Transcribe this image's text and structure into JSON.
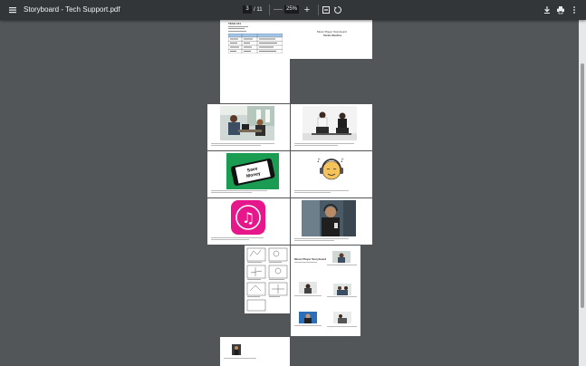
{
  "app": {
    "document_title": "Storyboard - Tech Support.pdf",
    "current_page": "3",
    "total_pages": "/ 11",
    "zoom_level": "25%",
    "zoom_out": "—",
    "zoom_in": "+"
  },
  "icons": {
    "menu": "menu-icon",
    "fit": "fit-page-icon",
    "rotate": "rotate-icon",
    "download": "download-icon",
    "print": "print-icon",
    "more": "more-vert-icon"
  },
  "pages": {
    "p1_heading": "TECH 101",
    "p2_title": "Music Player Storyboard",
    "p2_sub": "Tecko Studios",
    "p4_cta": "Save Money",
    "p8_title": "Music Player Storyboard"
  },
  "colors": {
    "toolbar": "#323639",
    "viewer_bg": "#525659",
    "green_phone_bg": "#1a9d53",
    "pink_app": "#e5178b"
  }
}
